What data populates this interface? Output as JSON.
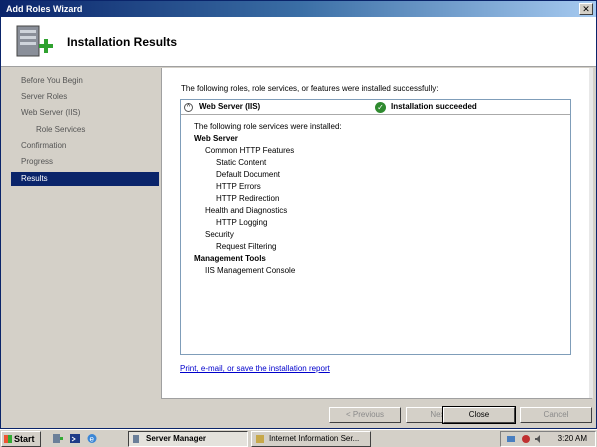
{
  "window": {
    "title": "Add Roles Wizard",
    "close_glyph": "✕"
  },
  "header": {
    "title": "Installation Results",
    "icon": "server-roles-add-icon"
  },
  "sidebar": {
    "items": [
      {
        "label": "Before You Begin"
      },
      {
        "label": "Server Roles"
      },
      {
        "label": "Web Server (IIS)"
      },
      {
        "label": "Role Services"
      },
      {
        "label": "Confirmation"
      },
      {
        "label": "Progress"
      },
      {
        "label": "Results"
      }
    ]
  },
  "content": {
    "intro": "The following roles, role services, or features were installed successfully:",
    "result": {
      "collapse_glyph": "^",
      "role": "Web Server (IIS)",
      "check_glyph": "✓",
      "status": "Installation succeeded",
      "lines": [
        "The following role services were installed:",
        "Web Server",
        "Common HTTP Features",
        "Static Content",
        "Default Document",
        "HTTP Errors",
        "HTTP Redirection",
        "Health and Diagnostics",
        "HTTP Logging",
        "Security",
        "Request Filtering",
        "Management Tools",
        "IIS Management Console"
      ]
    },
    "report_link": "Print, e-mail, or save the installation report"
  },
  "buttons": {
    "previous": "< Previous",
    "next": "Next >",
    "close": "Close",
    "cancel": "Cancel"
  },
  "taskbar": {
    "start": "Start",
    "tasks": [
      {
        "label": "Server Manager"
      },
      {
        "label": "Internet Information Ser..."
      }
    ],
    "clock": "3:20 AM"
  },
  "colors": {
    "selection": "#0a246a",
    "link": "#0000cc",
    "success": "#2f8a2f"
  }
}
